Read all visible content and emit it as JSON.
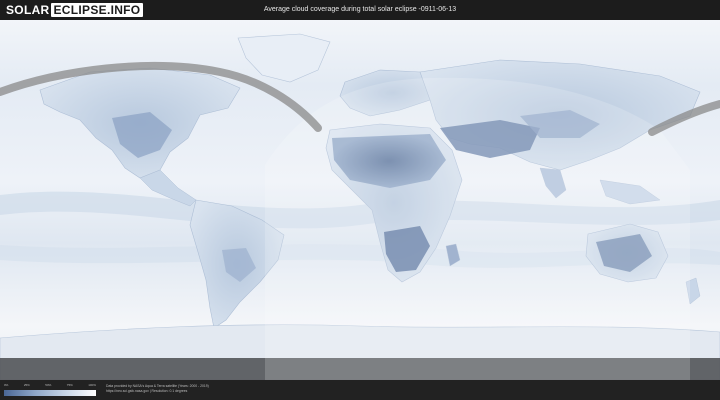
{
  "header": {
    "logo_part_a": "SOLAR",
    "logo_part_b": "ECLIPSE.INFO",
    "title": "Average cloud coverage during total solar eclipse -0911-06-13"
  },
  "legend": {
    "ticks": [
      "0%",
      "25%",
      "50%",
      "75%",
      "100%"
    ]
  },
  "credits": {
    "line1": "Data provided by NASA's Aqua & Terra satellite (Years: 2000 - 2019)",
    "line2": "https://neo.sci.gsfc.nasa.gov | Resolution: 0.1 degrees"
  },
  "colors": {
    "clear_sky": "#4a6796",
    "cloud": "#ffffff",
    "eclipse_path": "#8a8a8a"
  }
}
